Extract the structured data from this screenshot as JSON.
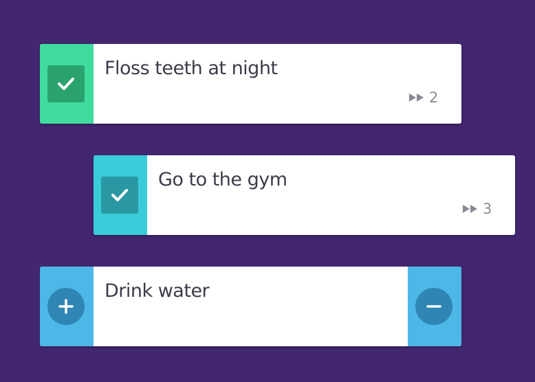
{
  "colors": {
    "background": "#42266f",
    "habit_done_1": "#3fdc9e",
    "habit_done_1_box": "#2ba36f",
    "habit_done_2": "#3acbd9",
    "habit_done_2_box": "#2a98a3",
    "counter_side": "#4db7e8",
    "counter_button": "#2f86b4"
  },
  "habits": [
    {
      "title": "Floss teeth at night",
      "checked": true,
      "streak": "2",
      "streak_icon": "fast-forward-icon"
    },
    {
      "title": "Go to the gym",
      "checked": true,
      "streak": "3",
      "streak_icon": "fast-forward-icon"
    }
  ],
  "counter": {
    "title": "Drink water",
    "increment_icon": "plus-icon",
    "decrement_icon": "minus-icon"
  }
}
